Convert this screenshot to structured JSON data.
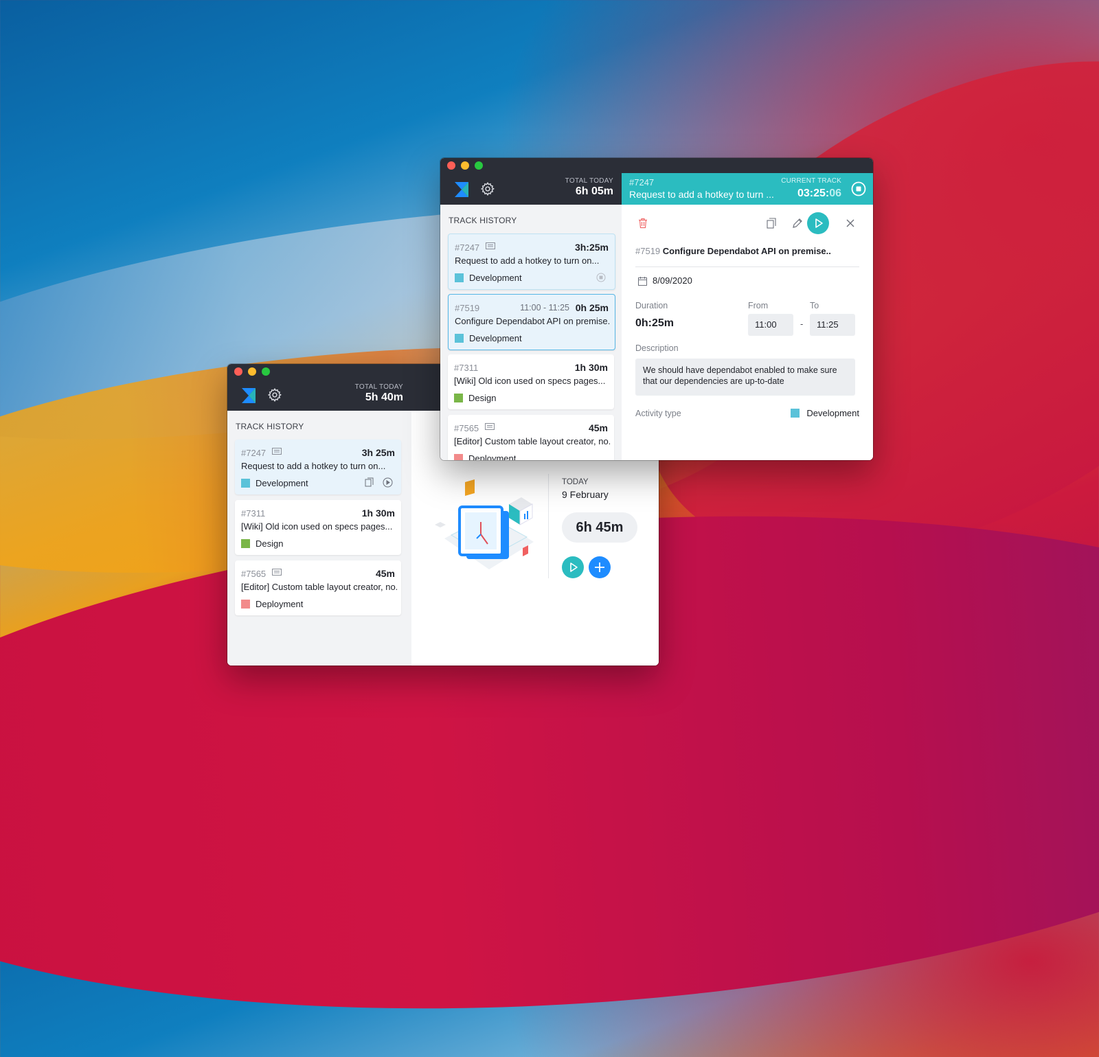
{
  "back_window": {
    "total_label": "TOTAL TODAY",
    "total_value": "5h 40m",
    "history_title": "TRACK HISTORY",
    "tracks": [
      {
        "id": "#7247",
        "duration": "3h 25m",
        "title": "Request to add a hotkey to turn on...",
        "tag": "Development",
        "tag_color": "#5bc2d9"
      },
      {
        "id": "#7311",
        "duration": "1h 30m",
        "title": "[Wiki] Old icon used on specs pages...",
        "tag": "Design",
        "tag_color": "#7ab648"
      },
      {
        "id": "#7565",
        "duration": "45m",
        "title": "[Editor] Custom table layout creator, no...",
        "tag": "Deployment",
        "tag_color": "#f28b8b"
      }
    ],
    "today_label": "TODAY",
    "today_date": "9 February",
    "today_total": "6h 45m"
  },
  "front_window": {
    "total_label": "TOTAL TODAY",
    "total_value": "6h 05m",
    "history_title": "TRACK HISTORY",
    "tracks": [
      {
        "id": "#7247",
        "duration": "3h:25m",
        "range": "",
        "title": "Request to add a hotkey to turn on...",
        "tag": "Development",
        "tag_color": "#5bc2d9"
      },
      {
        "id": "#7519",
        "duration": "0h 25m",
        "range": "11:00 - 11:25",
        "title": "Configure Dependabot API on premise...",
        "tag": "Development",
        "tag_color": "#5bc2d9"
      },
      {
        "id": "#7311",
        "duration": "1h 30m",
        "range": "",
        "title": "[Wiki] Old icon used on specs pages...",
        "tag": "Design",
        "tag_color": "#7ab648"
      },
      {
        "id": "#7565",
        "duration": "45m",
        "range": "",
        "title": "[Editor] Custom table layout creator, no...",
        "tag": "Deployment",
        "tag_color": "#f28b8b"
      }
    ],
    "current": {
      "id": "#7247",
      "title": "Request to add a hotkey to turn ...",
      "label": "CURRENT TRACK",
      "time_main": "03:25:",
      "time_sec": "06"
    },
    "detail": {
      "id": "#7519",
      "title": "Configure Dependabot API on premise..",
      "date": "8/09/2020",
      "duration_label": "Duration",
      "duration_value": "0h:25m",
      "from_label": "From",
      "from_value": "11:00",
      "separator": "-",
      "to_label": "To",
      "to_value": "11:25",
      "description_label": "Description",
      "description": "We should have dependabot enabled to make sure that our dependencies are up-to-date",
      "activity_label": "Activity type",
      "activity_value": "Development",
      "activity_color": "#5bc2d9"
    }
  }
}
